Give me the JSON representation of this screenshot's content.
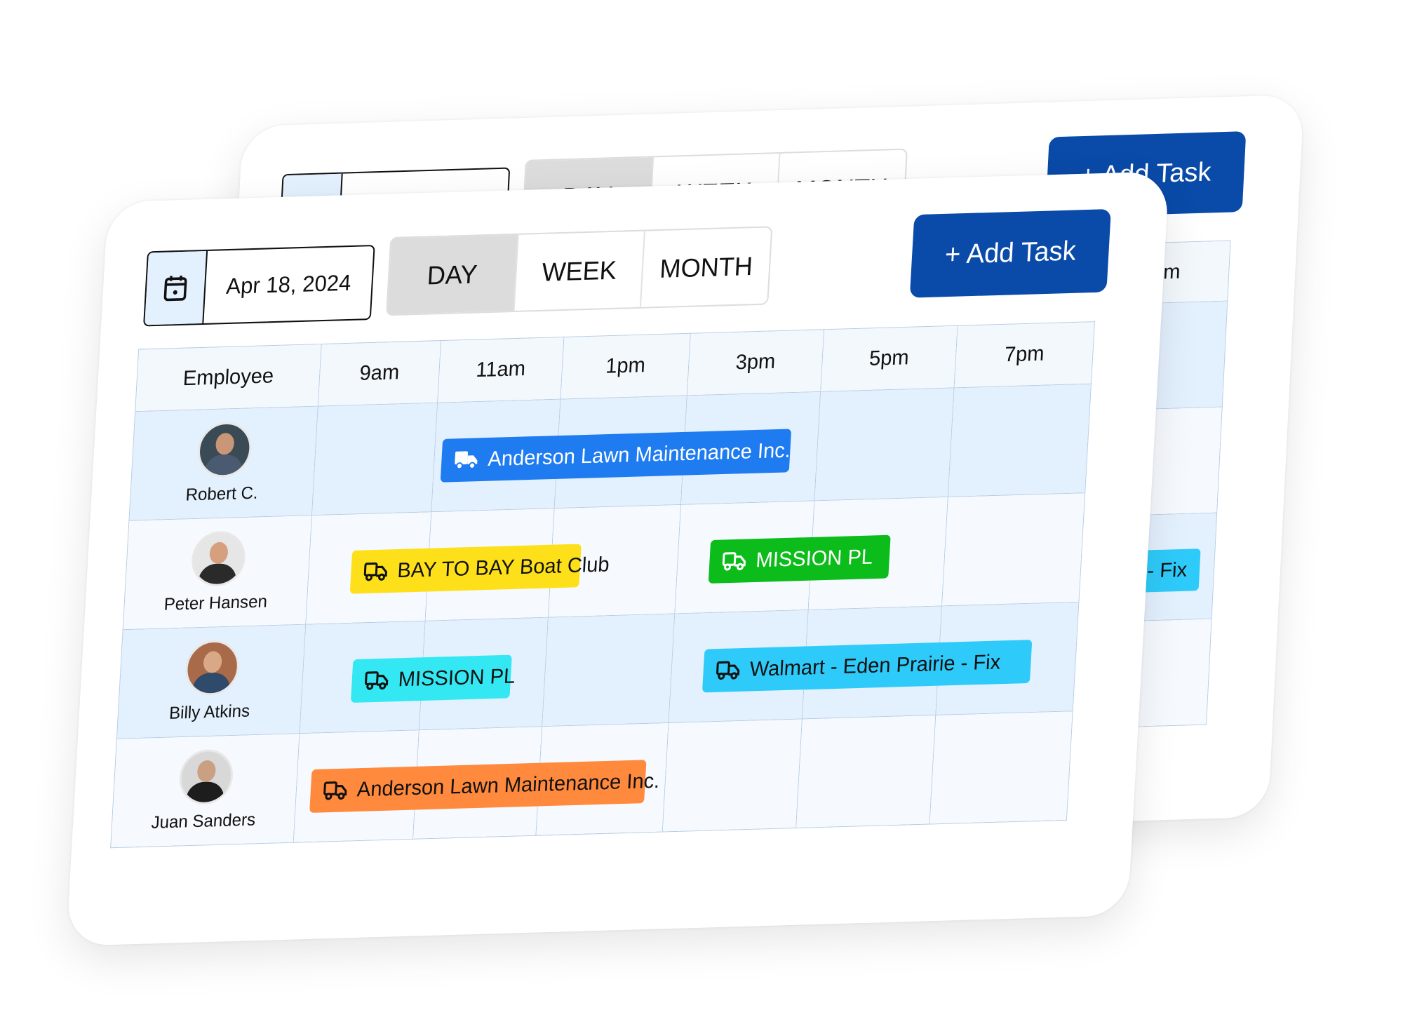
{
  "toolbar": {
    "date": "Apr 18, 2024",
    "views": [
      "DAY",
      "WEEK",
      "MONTH"
    ],
    "active_view": "DAY",
    "add_task_label": "+ Add Task"
  },
  "schedule": {
    "columns": [
      "Employee",
      "9am",
      "11am",
      "1pm",
      "3pm",
      "5pm",
      "7pm"
    ],
    "employees": [
      {
        "name": "Robert C.",
        "tasks": [
          {
            "label": "Anderson Lawn Maintenance Inc.",
            "color": "#1e7bf0"
          }
        ]
      },
      {
        "name": "Peter Hansen",
        "tasks": [
          {
            "label": "BAY TO BAY Boat Club",
            "color": "#fde01a"
          },
          {
            "label": "MISSION PL",
            "color": "#0cbc1a"
          }
        ]
      },
      {
        "name": "Billy Atkins",
        "tasks": [
          {
            "label": "MISSION PL",
            "color": "#33e8f2"
          },
          {
            "label": "Walmart - Eden Prairie - Fix",
            "color": "#2ecbfa"
          }
        ]
      },
      {
        "name": "Juan Sanders",
        "tasks": [
          {
            "label": "Anderson Lawn Maintenance Inc.",
            "color": "#ff8a3d"
          }
        ]
      }
    ]
  },
  "icons": {
    "date": "calendar-icon",
    "task": "truck-icon"
  },
  "colors": {
    "accent": "#0a4aa8",
    "row_highlight": "#e3f0fd",
    "grid": "#b7cde6"
  }
}
